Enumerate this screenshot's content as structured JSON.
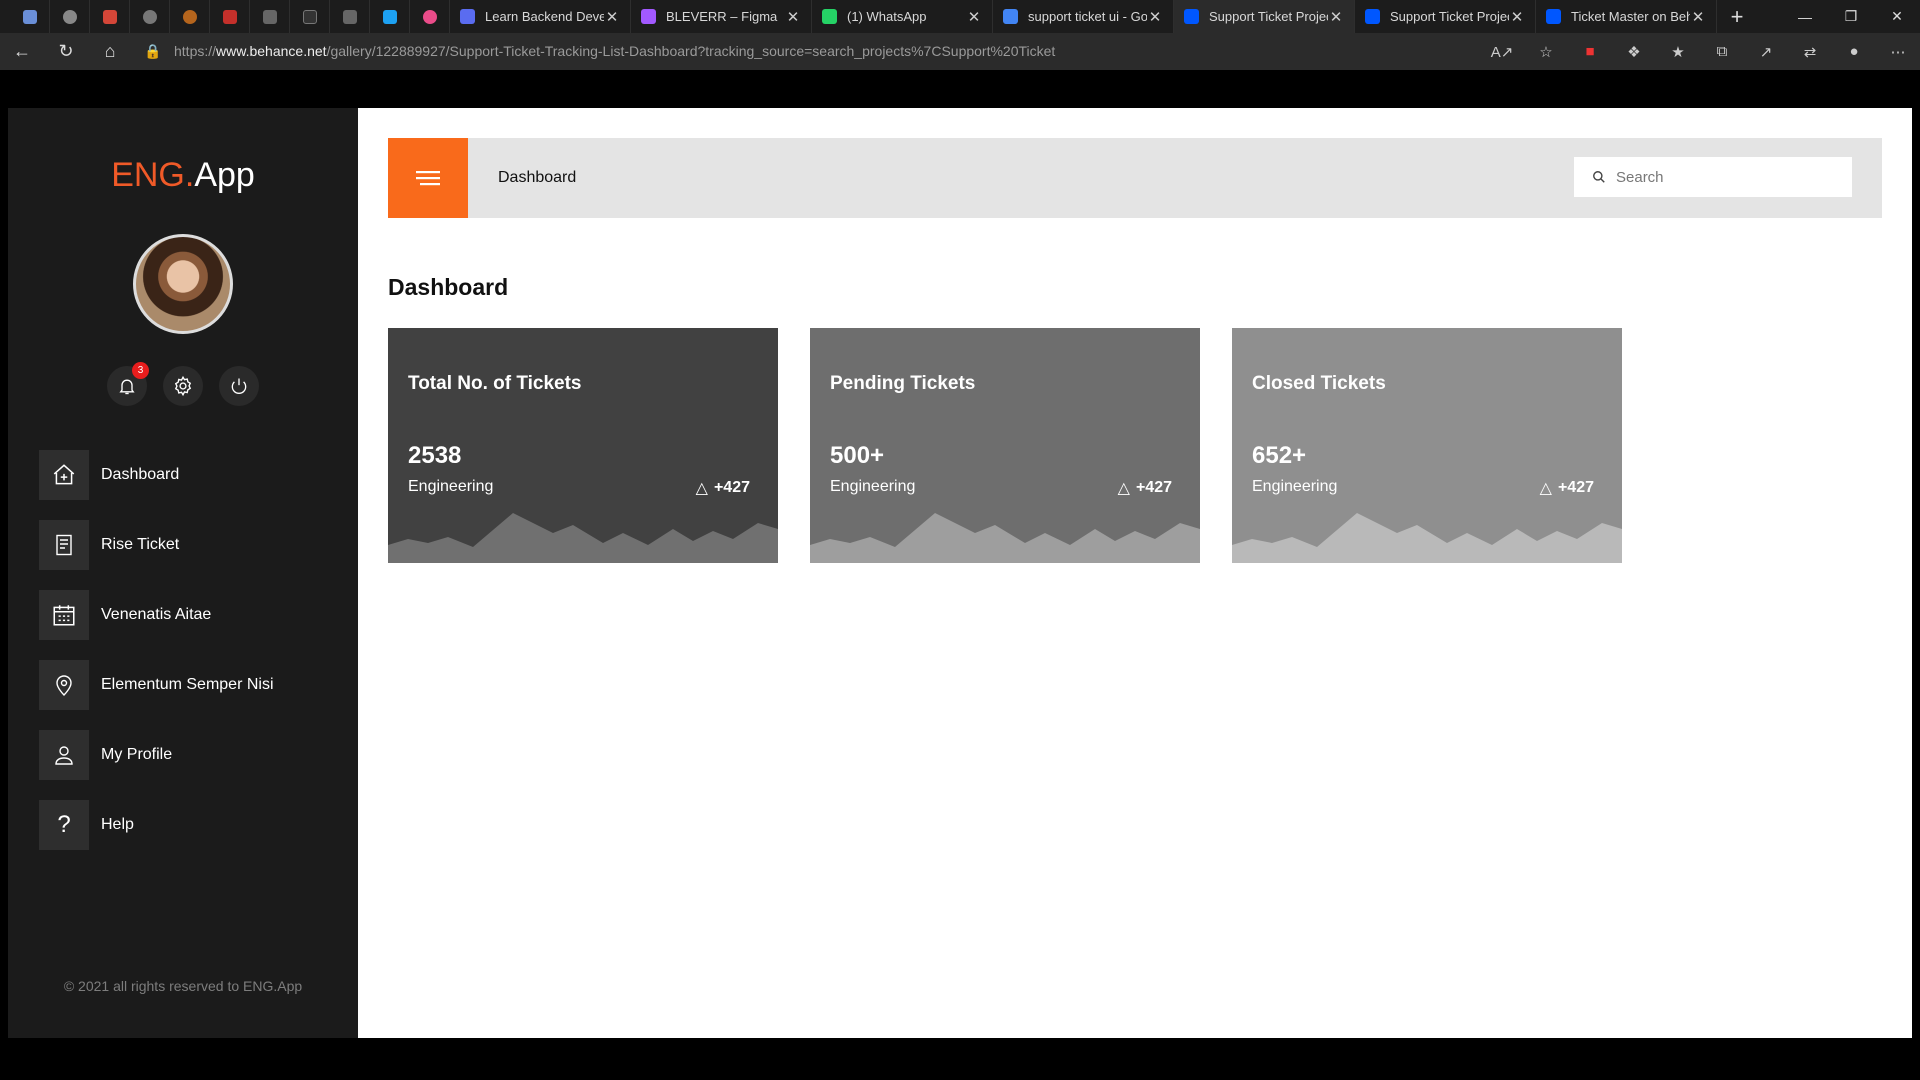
{
  "browser": {
    "tabs": [
      {
        "title": "Learn Backend Develo",
        "icon_color": "#5a6cf0",
        "active": false
      },
      {
        "title": "BLEVERR – Figma",
        "icon_color": "#a259ff",
        "active": false
      },
      {
        "title": "(1) WhatsApp",
        "icon_color": "#25d366",
        "active": false
      },
      {
        "title": "support ticket ui - Go",
        "icon_color": "#4285f4",
        "active": false
      },
      {
        "title": "Support Ticket Projec",
        "icon_color": "#0057ff",
        "active": true
      },
      {
        "title": "Support Ticket Projec",
        "icon_color": "#0057ff",
        "active": false
      },
      {
        "title": "Ticket Master on Beh",
        "icon_color": "#0057ff",
        "active": false
      }
    ],
    "url_prefix": "https://",
    "url_domain": "www.behance.net",
    "url_path": "/gallery/122889927/Support-Ticket-Tracking-List-Dashboard?tracking_source=search_projects%7CSupport%20Ticket"
  },
  "sidebar": {
    "logo_prefix": "ENG.",
    "logo_suffix": "App",
    "notification_count": "3",
    "items": [
      {
        "label": "Dashboard",
        "icon": "home-icon"
      },
      {
        "label": "Rise Ticket",
        "icon": "document-icon"
      },
      {
        "label": "Venenatis Aitae",
        "icon": "calendar-icon"
      },
      {
        "label": "Elementum Semper Nisi",
        "icon": "location-icon"
      },
      {
        "label": "My Profile",
        "icon": "user-icon"
      },
      {
        "label": "Help",
        "icon": "help-icon"
      }
    ],
    "copyright": "© 2021 all rights reserved to ENG.App"
  },
  "header": {
    "title": "Dashboard",
    "search_placeholder": "Search"
  },
  "page": {
    "title": "Dashboard"
  },
  "cards": [
    {
      "title": "Total No. of Tickets",
      "value": "2538",
      "subtitle": "Engineering",
      "delta": "+427",
      "bg": "#414141",
      "wave": "#707070"
    },
    {
      "title": "Pending Tickets",
      "value": "500+",
      "subtitle": "Engineering",
      "delta": "+427",
      "bg": "#6e6e6e",
      "wave": "#9e9e9e"
    },
    {
      "title": "Closed Tickets",
      "value": "652+",
      "subtitle": "Engineering",
      "delta": "+427",
      "bg": "#8f8f8f",
      "wave": "#b9b9b9"
    }
  ],
  "colors": {
    "accent": "#f96a1b",
    "logo_accent": "#f05a28",
    "sidebar_bg": "#1b1b1b"
  }
}
